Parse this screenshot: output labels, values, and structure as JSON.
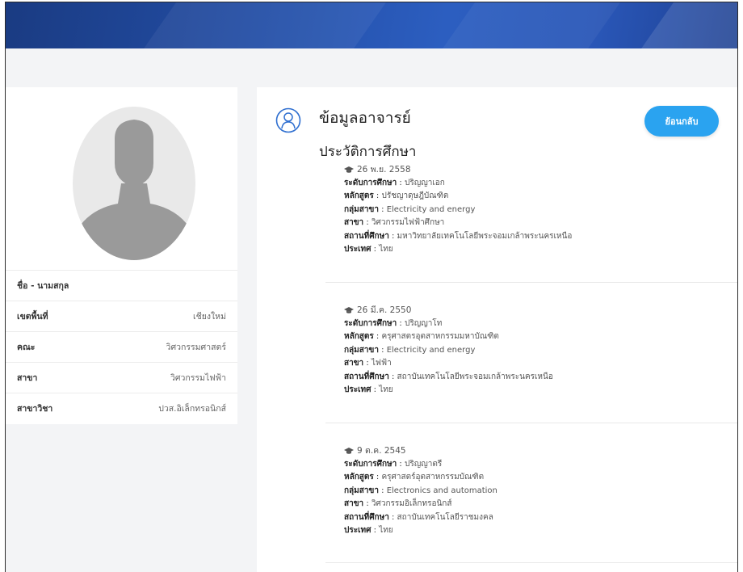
{
  "profile": {
    "name_label": "ชื่อ - นามสกุล",
    "rows": [
      {
        "label": "เขตพื้นที่",
        "value": "เชียงใหม่"
      },
      {
        "label": "คณะ",
        "value": "วิศวกรรมศาสตร์"
      },
      {
        "label": "สาขา",
        "value": "วิศวกรรมไฟฟ้า"
      },
      {
        "label": "สาขาวิชา",
        "value": "ปวส.อิเล็กทรอนิกส์"
      }
    ]
  },
  "main": {
    "title": "ข้อมูลอาจารย์",
    "back_label": "ย้อนกลับ",
    "section_title": "ประวัติการศึกษา"
  },
  "field_labels": {
    "level": "ระดับการศึกษา",
    "program": "หลักสูตร",
    "group": "กลุ่มสาขา",
    "major": "สาขา",
    "institute": "สถานที่ศึกษา",
    "country": "ประเทศ"
  },
  "education": [
    {
      "date": "26 พ.ย. 2558",
      "level": "ปริญญาเอก",
      "program": "ปรัชญาดุษฎีบัณฑิต",
      "group": "Electricity and energy",
      "major": "วิศวกรรมไฟฟ้าศึกษา",
      "institute": "มหาวิทยาลัยเทคโนโลยีพระจอมเกล้าพระนครเหนือ",
      "country": "ไทย"
    },
    {
      "date": "26 มี.ค. 2550",
      "level": "ปริญญาโท",
      "program": "ครุศาสตรอุตสาหกรรมมหาบัณฑิต",
      "group": "Electricity and energy",
      "major": "ไฟฟ้า",
      "institute": "สถาบันเทคโนโลยีพระจอมเกล้าพระนครเหนือ",
      "country": "ไทย"
    },
    {
      "date": "9 ต.ค. 2545",
      "level": "ปริญญาตรี",
      "program": "ครุศาสตร์อุตสาหกรรมบัณฑิต",
      "group": "Electronics and automation",
      "major": "วิศวกรรมอิเล็กทรอนิกส์",
      "institute": "สถาบันเทคโนโลยีราชมงคล",
      "country": "ไทย"
    }
  ],
  "colors": {
    "banner": "#234ea6",
    "accent": "#2aa3f0",
    "page_bg": "#f3f4f6"
  }
}
